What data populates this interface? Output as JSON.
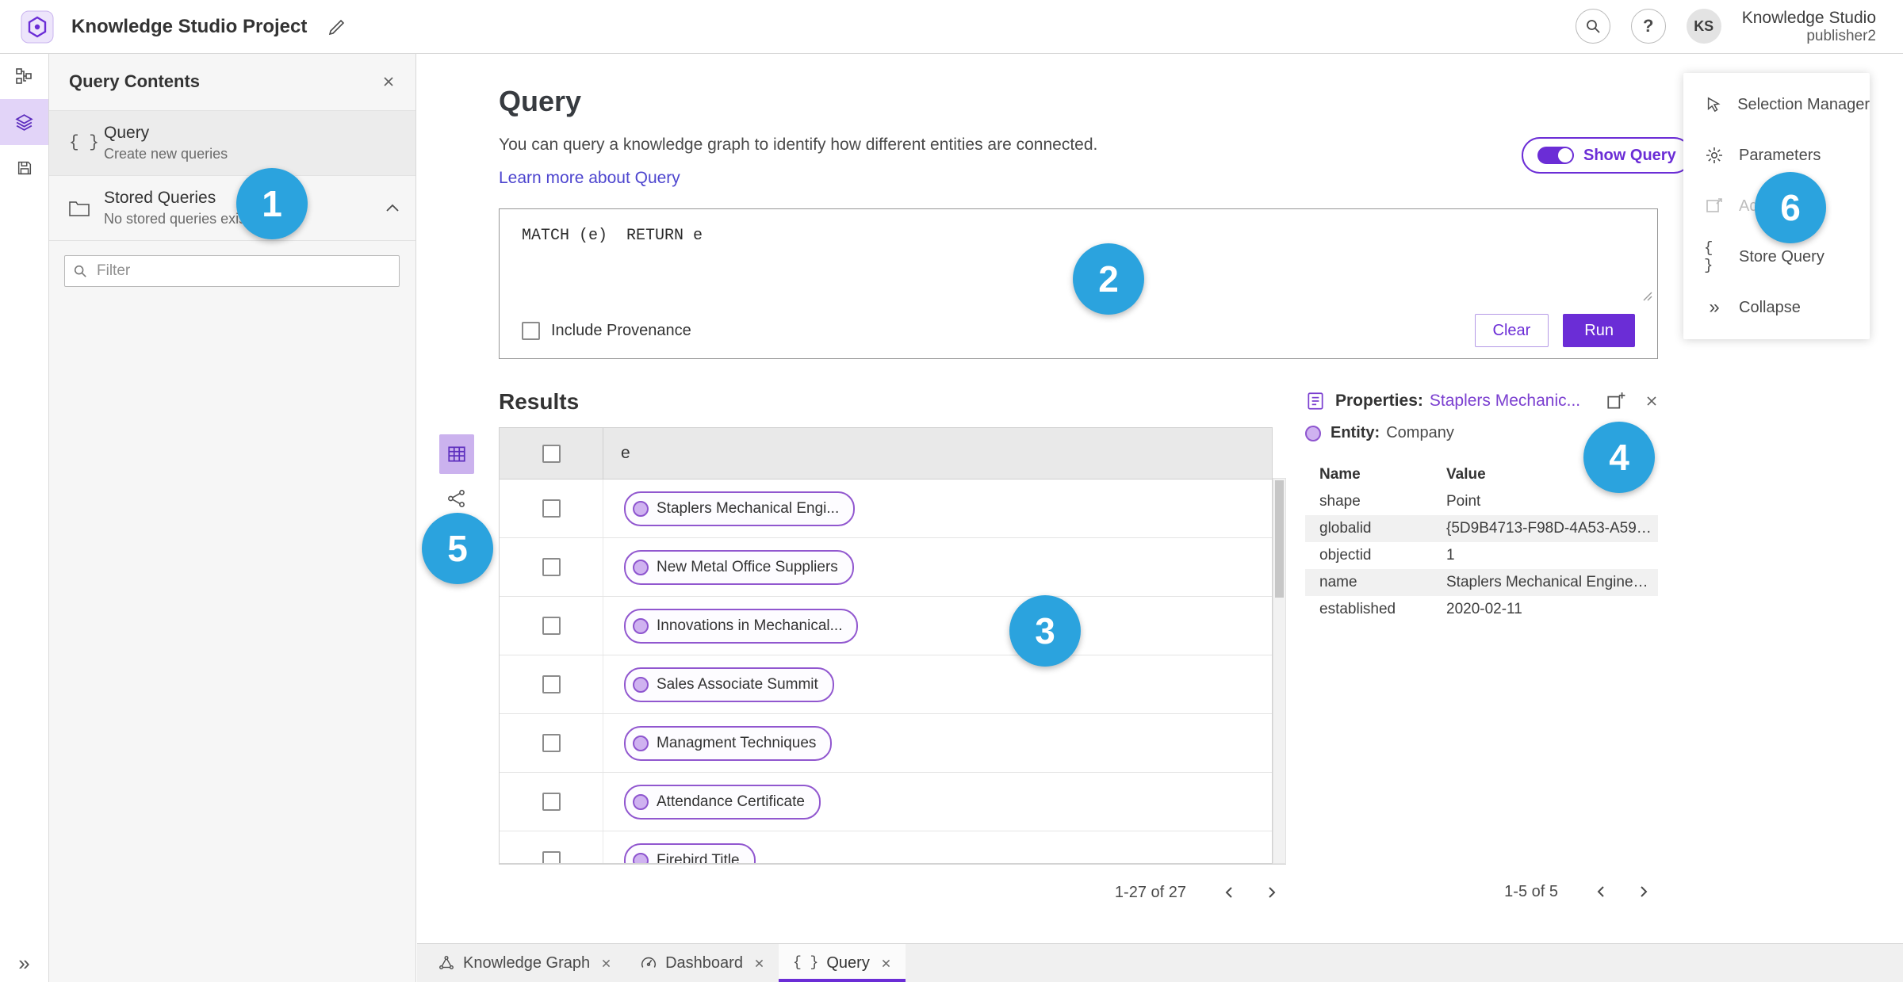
{
  "colors": {
    "accent_purple": "#6b2dd6",
    "pill_border_purple": "#9157cf",
    "entity_fill_purple": "#cfb2f0",
    "link_color": "#4d45cf",
    "annotation_blue": "#2ba3de"
  },
  "icons": {
    "braces": "{ }",
    "double_chevron_right": "»",
    "question_mark": "?"
  },
  "topbar": {
    "title": "Knowledge Studio Project",
    "avatar_initials": "KS",
    "user_name": "Knowledge Studio",
    "user_role": "publisher2"
  },
  "contents_panel": {
    "title": "Query Contents",
    "query_item": {
      "title": "Query",
      "subtitle": "Create new queries"
    },
    "stored_queries": {
      "title": "Stored Queries",
      "subtitle": "No stored queries exist"
    },
    "filter_placeholder": "Filter"
  },
  "query_section": {
    "heading": "Query",
    "description": "You can query a knowledge graph to identify how different entities are connected.",
    "learn_more": "Learn more about Query",
    "show_query_label": "Show Query",
    "editor_text": "MATCH (e)  RETURN e",
    "include_provenance": "Include Provenance",
    "clear_button": "Clear",
    "run_button": "Run"
  },
  "results": {
    "heading": "Results",
    "column_header": "e",
    "rows": [
      "Staplers Mechanical Engi...",
      "New Metal Office Suppliers",
      "Innovations in Mechanical...",
      "Sales Associate Summit",
      "Managment Techniques",
      "Attendance Certificate",
      "Firebird Title"
    ],
    "pagination": "1-27 of 27"
  },
  "properties_panel": {
    "label": "Properties:",
    "selected_entity": "Staplers Mechanic...",
    "entity_label": "Entity:",
    "entity_type": "Company",
    "columns": {
      "name": "Name",
      "value": "Value"
    },
    "rows": [
      [
        "shape",
        "Point"
      ],
      [
        "globalid",
        "{5D9B4713-F98D-4A53-A59F-C11..."
      ],
      [
        "objectid",
        "1"
      ],
      [
        "name",
        "Staplers Mechanical Engineering"
      ],
      [
        "established",
        "2020-02-11"
      ]
    ],
    "pagination": "1-5 of 5"
  },
  "tools_menu": {
    "items": [
      {
        "label": "Selection Manager"
      },
      {
        "label": "Parameters"
      },
      {
        "label": "Add To Map",
        "disabled": true
      },
      {
        "label": "Store Query"
      },
      {
        "label": "Collapse"
      }
    ]
  },
  "bottom_tabs": [
    {
      "label": "Knowledge Graph"
    },
    {
      "label": "Dashboard"
    },
    {
      "label": "Query",
      "active": true
    }
  ],
  "annotations": [
    "1",
    "2",
    "3",
    "4",
    "5",
    "6"
  ]
}
